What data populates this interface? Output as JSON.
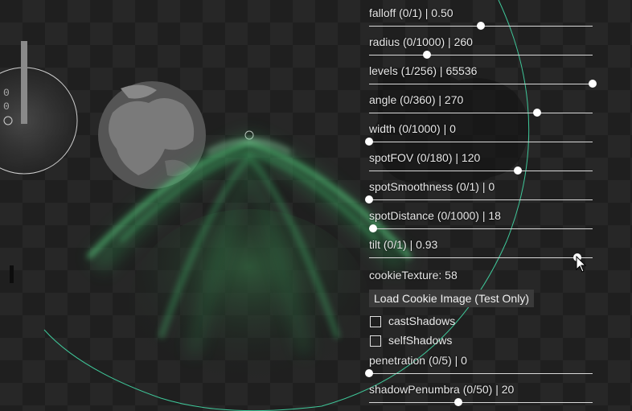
{
  "sliders_top": [
    {
      "id": "falloff",
      "label": "falloff  (0/1) | 0.50",
      "min": 0,
      "max": 1,
      "value": 0.5
    },
    {
      "id": "radius",
      "label": "radius  (0/1000) | 260",
      "min": 0,
      "max": 1000,
      "value": 260
    },
    {
      "id": "levels",
      "label": "levels  (1/256) | 65536",
      "min": 1,
      "max": 256,
      "value": 256
    },
    {
      "id": "angle",
      "label": "angle  (0/360) | 270",
      "min": 0,
      "max": 360,
      "value": 270
    },
    {
      "id": "width",
      "label": "width  (0/1000) | 0",
      "min": 0,
      "max": 1000,
      "value": 0
    },
    {
      "id": "spotfov",
      "label": "spotFOV  (0/180) | 120",
      "min": 0,
      "max": 180,
      "value": 120
    },
    {
      "id": "spotsmoothness",
      "label": "spotSmoothness  (0/1) | 0",
      "min": 0,
      "max": 1,
      "value": 0
    },
    {
      "id": "spotdistance",
      "label": "spotDistance  (0/1000) | 18",
      "min": 0,
      "max": 1000,
      "value": 18
    },
    {
      "id": "tilt",
      "label": "tilt  (0/1) | 0.93",
      "min": 0,
      "max": 1,
      "value": 0.93
    }
  ],
  "cookie_texture_label": "cookieTexture: 58",
  "load_cookie_button": "Load Cookie Image (Test Only)",
  "checkboxes": [
    {
      "id": "castshadows",
      "label": "castShadows",
      "checked": false
    },
    {
      "id": "selfshadows",
      "label": "selfShadows",
      "checked": false
    }
  ],
  "sliders_bottom": [
    {
      "id": "penetration",
      "label": "penetration  (0/5) | 0",
      "min": 0,
      "max": 5,
      "value": 0
    },
    {
      "id": "shadowpenumbra",
      "label": "shadowPenumbra  (0/50) | 20",
      "min": 0,
      "max": 50,
      "value": 20
    }
  ],
  "left_readout": [
    "0",
    "0"
  ],
  "colors": {
    "light_glow": "#5fe08a",
    "light_outline": "#3fc89a",
    "panel_text": "#e8e8e8"
  }
}
